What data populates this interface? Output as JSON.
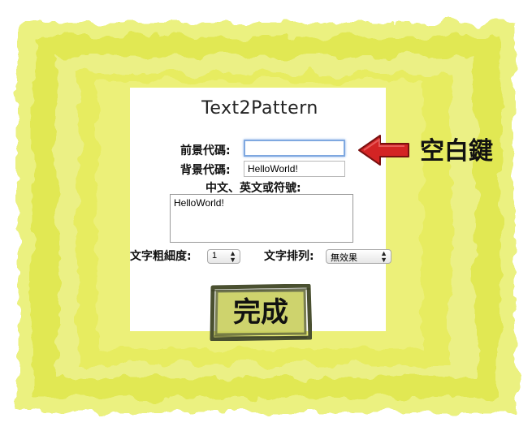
{
  "title": "Text2Pattern",
  "form": {
    "fg_label": "前景代碼:",
    "fg_value": "",
    "bg_label": "背景代碼:",
    "bg_value": "HelloWorld!",
    "text_label": "中文、英文或符號:",
    "text_value": "HelloWorld!",
    "weight_label": "文字粗細度:",
    "weight_value": "1",
    "arrange_label": "文字排列:",
    "arrange_value": "無效果"
  },
  "submit_label": "完成",
  "annotation": {
    "text": "空白鍵",
    "arrow_color": "#d32424"
  },
  "colors": {
    "frame": "#e3ea4c",
    "frame_dark": "#c9d22a",
    "focus_border": "#7fa8e0"
  }
}
